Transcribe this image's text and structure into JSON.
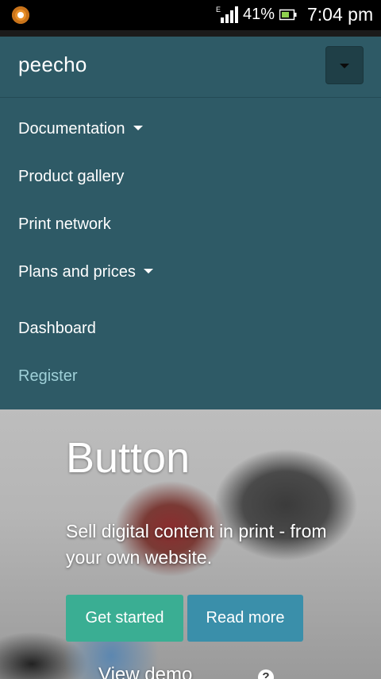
{
  "status_bar": {
    "network_type": "E",
    "battery_percent": "41%",
    "time": "7:04 pm"
  },
  "header": {
    "brand": "peecho",
    "toggle_icon": "caret-down-icon"
  },
  "menu": {
    "items": [
      {
        "label": "Documentation",
        "has_dropdown": true
      },
      {
        "label": "Product gallery",
        "has_dropdown": false
      },
      {
        "label": "Print network",
        "has_dropdown": false
      },
      {
        "label": "Plans and prices",
        "has_dropdown": true
      },
      {
        "label": "Dashboard",
        "has_dropdown": false
      },
      {
        "label": "Register",
        "has_dropdown": false
      }
    ]
  },
  "hero": {
    "title": "Button",
    "subtitle": "Sell digital content in print - from your own website.",
    "primary_button": "Get started",
    "secondary_button": "Read more",
    "demo_link": "View demo",
    "help_icon": "?"
  },
  "colors": {
    "nav_bg": "#2e5a66",
    "primary_button": "#3aae93",
    "secondary_button": "#3a8faa",
    "muted_link": "#9fd0d8"
  }
}
